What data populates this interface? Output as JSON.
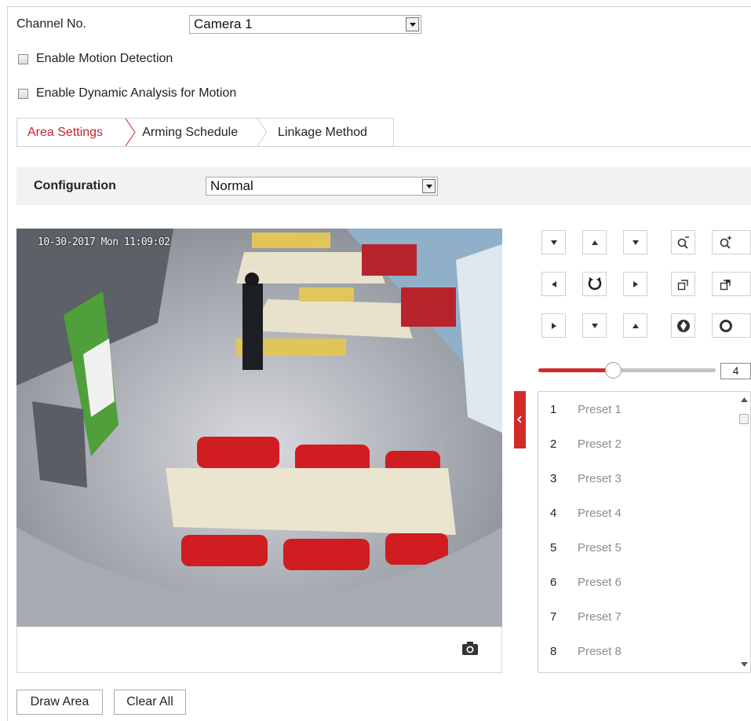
{
  "channel": {
    "label": "Channel No.",
    "value": "Camera 1"
  },
  "checkboxes": {
    "motion_detection": "Enable Motion Detection",
    "dynamic_analysis": "Enable Dynamic Analysis for Motion"
  },
  "tabs": [
    {
      "label": "Area Settings",
      "active": true
    },
    {
      "label": "Arming Schedule",
      "active": false
    },
    {
      "label": "Linkage Method",
      "active": false
    }
  ],
  "configuration": {
    "label": "Configuration",
    "value": "Normal"
  },
  "video": {
    "osd_text": "10-30-2017 Mon 11:09:02"
  },
  "ptz": {
    "speed_value": "4",
    "speed_fraction": 0.42,
    "icons": [
      "arrow-down-left-icon",
      "arrow-up-icon",
      "arrow-down-right-icon",
      "zoom-out-icon",
      "zoom-in-icon",
      "arrow-left-icon",
      "auto-scan-icon",
      "arrow-right-icon",
      "focus-near-icon",
      "focus-far-icon",
      "arrow-up-left-icon",
      "arrow-down-icon",
      "arrow-up-right-icon",
      "iris-close-icon",
      "iris-open-icon"
    ]
  },
  "presets": [
    {
      "num": "1",
      "name": "Preset 1"
    },
    {
      "num": "2",
      "name": "Preset 2"
    },
    {
      "num": "3",
      "name": "Preset 3"
    },
    {
      "num": "4",
      "name": "Preset 4"
    },
    {
      "num": "5",
      "name": "Preset 5"
    },
    {
      "num": "6",
      "name": "Preset 6"
    },
    {
      "num": "7",
      "name": "Preset 7"
    },
    {
      "num": "8",
      "name": "Preset 8"
    }
  ],
  "buttons": {
    "draw_area": "Draw Area",
    "clear_all": "Clear All"
  },
  "colors": {
    "accent": "#c8232c",
    "slider_fill": "#d32a2a",
    "config_bg": "#f2f2f2"
  }
}
